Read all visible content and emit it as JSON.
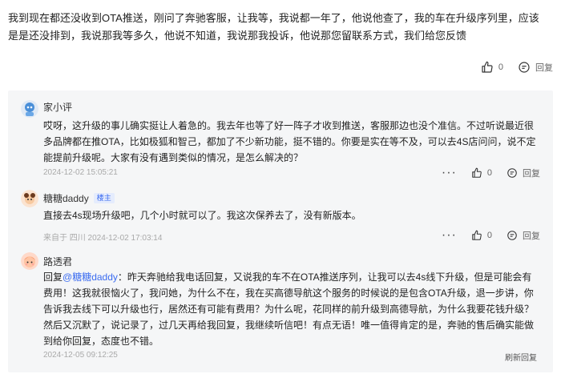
{
  "main": {
    "text": "我到现在都还没收到OTA推送，刚问了奔驰客服，让我等，我说都一年了，他说他查了，我的车在升级序列里，应该是是还没排到，我说那我等多久，他说不知道，我说那我投诉，他说那您留联系方式，我们给您反馈",
    "likes": "0",
    "reply_label": "回复"
  },
  "replies": [
    {
      "name": "家小评",
      "body": "哎呀，这升级的事儿确实挺让人着急的。我去年也等了好一阵子才收到推送，客服那边也没个准信。不过听说最近很多品牌都在推OTA，比如极狐和智己，都加了不少新功能，挺不错的。你要是实在等不及，可以去4S店问问，说不定能提前升级呢。大家有没有遇到类似的情况，是怎么解决的？",
      "meta": "2024-12-02 15:05:21",
      "likes": "0",
      "reply_label": "回复"
    },
    {
      "name": "糖糖daddy",
      "badge": "楼主",
      "body": "直接去4s现场升级吧，几个小时就可以了。我这次保养去了，没有新版本。",
      "meta": "来自于 四川 2024-12-02 17:03:14",
      "likes": "0",
      "reply_label": "回复"
    },
    {
      "name": "路透君",
      "body_prefix": "回复",
      "mention": "@糖糖daddy",
      "body": "：昨天奔驰给我电话回复，又说我的车不在OTA推送序列，让我可以去4s线下升级，但是可能会有费用！这我就很恼火了，我问她，为什么不在，我在买高德导航这个服务的时候说的是包含OTA升级，退一步讲，你告诉我去线下可以升级也行，居然还有可能有费用？为什么呢，花同样的前升级到高德导航，为什么我要花钱升级？然后又沉默了，说记录了，过几天再给我回复，我继续听信吧！有点无语！唯一值得肯定的是，奔驰的售后确实能做到给你回复，态度也不错。",
      "meta": "2024-12-05 09:12:25",
      "refresh_label": "刷新回复"
    }
  ],
  "icons": {
    "like": "thumbs-up-icon",
    "reply": "comment-icon",
    "more": "more-dots-icon"
  },
  "colors": {
    "panel_bg": "#f5f6f7",
    "link_blue": "#3b6cf0",
    "meta_gray": "#a9a9a9"
  }
}
